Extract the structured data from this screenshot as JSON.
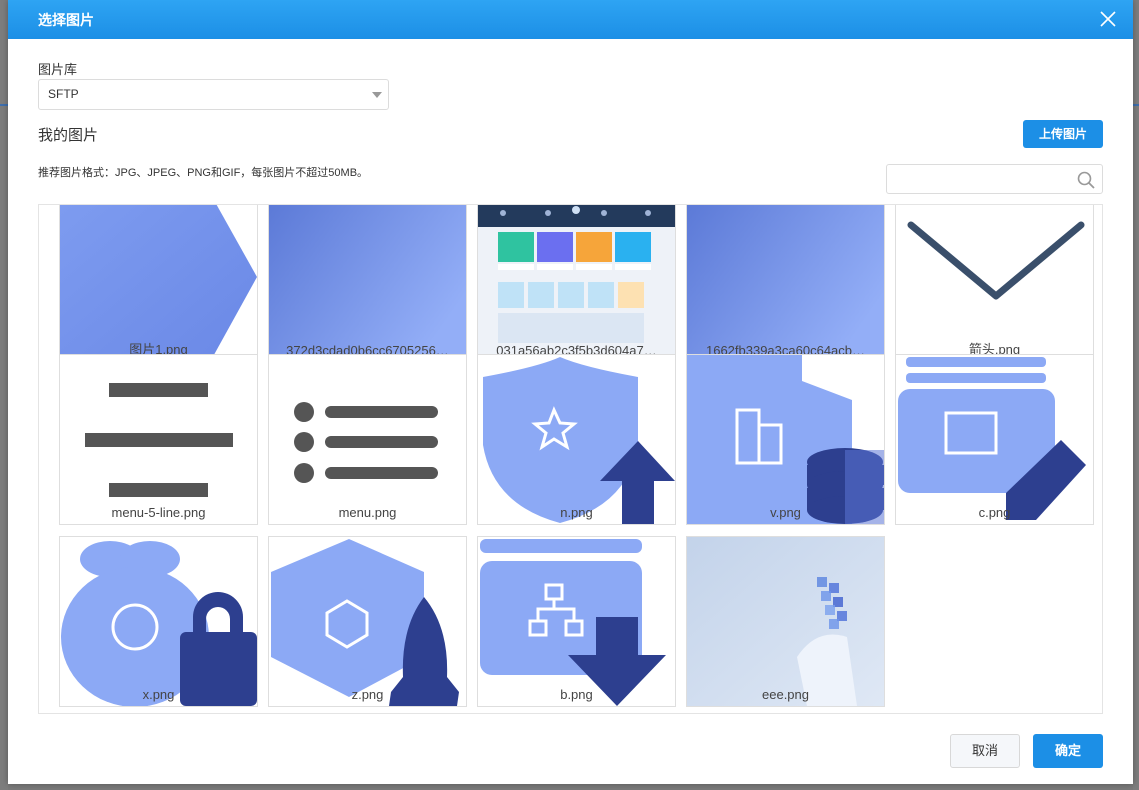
{
  "dialog": {
    "title": "选择图片",
    "library_label": "图片库",
    "library_value": "SFTP",
    "my_images_title": "我的图片",
    "upload_label": "上传图片",
    "hint": "推荐图片格式：JPG、JPEG、PNG和GIF，每张图片不超过50MB。",
    "search_placeholder": "",
    "cancel_label": "取消",
    "confirm_label": "确定"
  },
  "images": [
    {
      "name": "图片1.png",
      "icon": "blue-arrow-shape"
    },
    {
      "name": "372d3cdad0b6cc6705256…",
      "icon": "blue-gradient"
    },
    {
      "name": "031a56ab2c3f5b3d604a7…",
      "icon": "dashboard-screenshot"
    },
    {
      "name": "1662fb339a3ca60c64acb…",
      "icon": "blue-gradient"
    },
    {
      "name": "箭头.png",
      "icon": "chevron-down-icon"
    },
    {
      "name": "menu-5-line.png",
      "icon": "menu-lines-icon"
    },
    {
      "name": "menu.png",
      "icon": "menu-list-icon"
    },
    {
      "name": "n.png",
      "icon": "shield-star-upload-icon"
    },
    {
      "name": "v.png",
      "icon": "building-database-icon"
    },
    {
      "name": "c.png",
      "icon": "receipt-edit-icon"
    },
    {
      "name": "x.png",
      "icon": "money-bag-lock-icon"
    },
    {
      "name": "z.png",
      "icon": "hexagon-rocket-icon"
    },
    {
      "name": "b.png",
      "icon": "sitemap-download-icon"
    },
    {
      "name": "eee.png",
      "icon": "tech-hand-photo"
    }
  ],
  "colors": {
    "accent": "#1c8fe6",
    "thumb_blue": "#8ca9f5",
    "thumb_dark": "#2d3f8f"
  }
}
